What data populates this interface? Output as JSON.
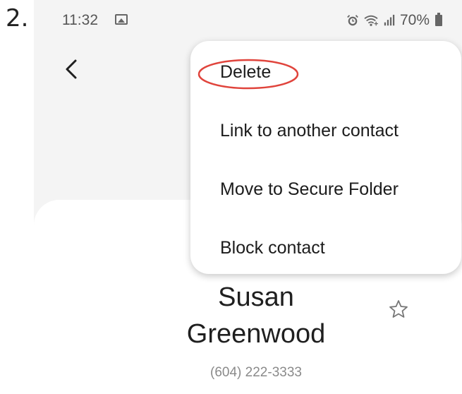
{
  "step_number": "2.",
  "status_bar": {
    "time": "11:32",
    "battery": "70%",
    "icons": [
      "gallery-icon",
      "alarm-icon",
      "wifi-icon",
      "signal-icon",
      "battery-icon"
    ]
  },
  "menu": {
    "items": [
      {
        "label": "Delete",
        "highlighted": true
      },
      {
        "label": "Link to another contact"
      },
      {
        "label": "Move to Secure Folder"
      },
      {
        "label": "Block contact"
      }
    ],
    "highlight_color": "#e0443c"
  },
  "contact": {
    "name_line1": "Susan",
    "name_line2": "Greenwood",
    "phone": "(604) 222-3333"
  }
}
